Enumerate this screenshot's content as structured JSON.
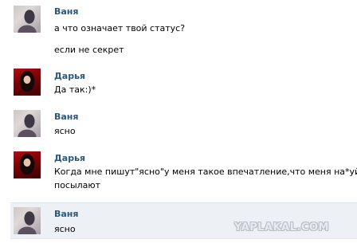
{
  "messages": [
    {
      "author": "Ваня",
      "avatar": "vanya-avatar",
      "lines": [
        "а что означает твой статус?",
        "если не секрет"
      ],
      "highlighted": false
    },
    {
      "author": "Дарья",
      "avatar": "darya-avatar",
      "lines": [
        "Да так:)*"
      ],
      "highlighted": false
    },
    {
      "author": "Ваня",
      "avatar": "vanya-avatar",
      "lines": [
        "ясно"
      ],
      "highlighted": false
    },
    {
      "author": "Дарья",
      "avatar": "darya-avatar",
      "lines": [
        "Когда мне пишут\"ясно\"у меня такое впечатление,что меня на*уй",
        "посылают"
      ],
      "highlighted": false
    },
    {
      "author": "Ваня",
      "avatar": "vanya-avatar",
      "lines": [
        "ясно"
      ],
      "highlighted": true
    }
  ],
  "watermark": "YAPLAKAL.COM",
  "colors": {
    "author_name": "#2b587a",
    "highlight_bg": "#edf1f5",
    "text": "#000000"
  }
}
